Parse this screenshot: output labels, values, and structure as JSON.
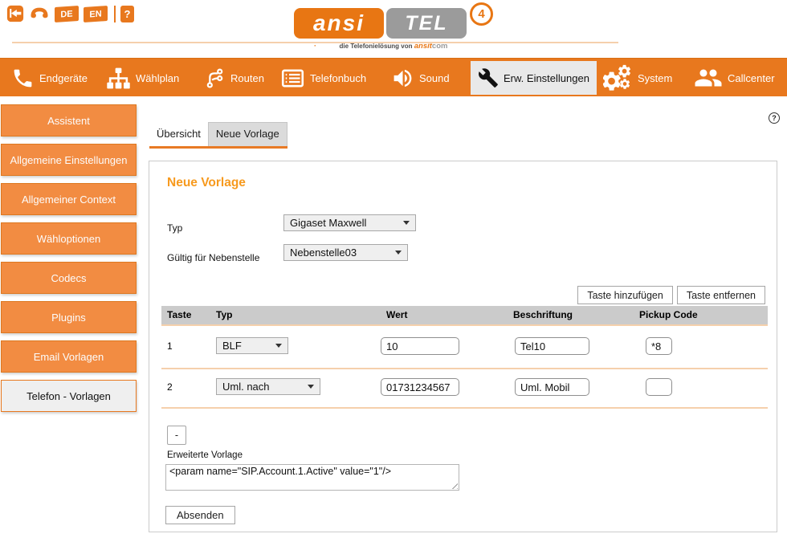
{
  "header": {
    "lang_de": "DE",
    "lang_en": "EN",
    "help_label": "?",
    "logo": {
      "part1": "ansi",
      "part2": "TEL",
      "version": "4",
      "tagline": "die Telefonielösung von",
      "tagline_brand": "ansit",
      "tagline_sep": "·",
      "tagline_suffix": "com"
    }
  },
  "help_icon_label": "?",
  "nav": {
    "items": [
      {
        "label": "Endgeräte",
        "icon": "phone-icon",
        "active": false
      },
      {
        "label": "Wählplan",
        "icon": "dialplan-icon",
        "active": false
      },
      {
        "label": "Routen",
        "icon": "routes-icon",
        "active": false
      },
      {
        "label": "Telefonbuch",
        "icon": "phonebook-icon",
        "active": false
      },
      {
        "label": "Sound",
        "icon": "speaker-icon",
        "active": false
      },
      {
        "label": "Erw. Einstellungen",
        "icon": "wrench-icon",
        "active": true
      },
      {
        "label": "System",
        "icon": "gears-icon",
        "active": false
      },
      {
        "label": "Callcenter",
        "icon": "people-icon",
        "active": false
      }
    ]
  },
  "sidebar": {
    "items": [
      {
        "label": "Assistent",
        "active": false
      },
      {
        "label": "Allgemeine Einstellungen",
        "active": false
      },
      {
        "label": "Allgemeiner Context",
        "active": false
      },
      {
        "label": "Wähloptionen",
        "active": false
      },
      {
        "label": "Codecs",
        "active": false
      },
      {
        "label": "Plugins",
        "active": false
      },
      {
        "label": "Email Vorlagen",
        "active": false
      },
      {
        "label": "Telefon - Vorlagen",
        "active": true
      }
    ]
  },
  "tabs": {
    "items": [
      {
        "label": "Übersicht",
        "active": true
      },
      {
        "label": "Neue Vorlage",
        "active": false
      }
    ]
  },
  "main": {
    "title": "Neue Vorlage",
    "fields": [
      {
        "label": "Typ",
        "value": "Gigaset Maxwell"
      },
      {
        "label": "Gültig für Nebenstelle",
        "value": "Nebenstelle03"
      }
    ],
    "add_button": "Taste hinzufügen",
    "remove_button": "Taste entfernen",
    "table": {
      "headers": [
        "Taste",
        "Typ",
        "Wert",
        "Beschriftung",
        "Pickup Code"
      ],
      "rows": [
        {
          "nr": "1",
          "typ": "BLF",
          "wert": "10",
          "beschriftung": "Tel10",
          "pickup": "*8"
        },
        {
          "nr": "2",
          "typ": "Uml. nach",
          "wert": "01731234567",
          "beschriftung": "Uml. Mobil",
          "pickup": ""
        }
      ]
    },
    "minus_label": "-",
    "advanced_label": "Erweiterte Vorlage",
    "advanced_value": "<param name=\"SIP.Account.1.Active\" value=\"1\"/>",
    "submit_label": "Absenden"
  },
  "colors": {
    "nav_orange": "#E8781E",
    "logo_orange": "#E87613",
    "logo_gray": "#9B9B9B",
    "sidebar_orange": "#F28C42",
    "heading_orange": "#F79A1E",
    "table_header_bg": "#CBCBCB",
    "row_separator": "#F5D0AC",
    "active_bg": "#EFEFEF"
  }
}
